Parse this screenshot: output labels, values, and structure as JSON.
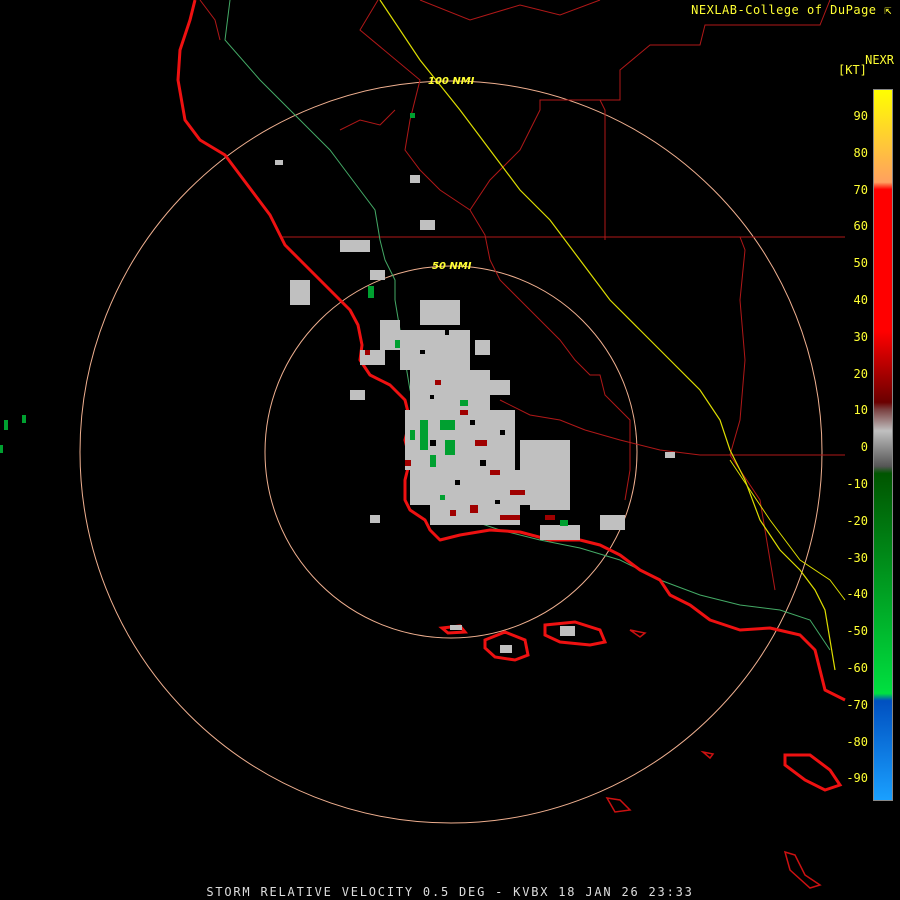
{
  "header": {
    "credit": "NEXLAB-College of DuPage",
    "credit_icon": "cursor-arrow-icon",
    "product": "NEXR",
    "unit": "[KT]"
  },
  "footer": {
    "caption": "STORM RELATIVE VELOCITY 0.5 DEG - KVBX 18 JAN 26 23:33"
  },
  "range_rings": [
    {
      "label": "100 NMI"
    },
    {
      "label": "50 NMI"
    }
  ],
  "legend": {
    "ticks": [
      "90",
      "80",
      "70",
      "60",
      "50",
      "40",
      "30",
      "20",
      "10",
      "0",
      "-10",
      "-20",
      "-30",
      "-40",
      "-50",
      "-60",
      "-70",
      "-80",
      "-90"
    ],
    "colors": {
      "yellow": "#ffff00",
      "orange": "#ffa060",
      "red": "#ff0000",
      "dark_red": "#6a0000",
      "gray": "#c0c0c0",
      "dark_green": "#005500",
      "green": "#00e040",
      "blue": "#0050c0",
      "light_blue": "#1aa0ff"
    }
  },
  "map": {
    "coastline_color": "#ee1111",
    "county_color": "#b01818",
    "road_green_color": "#44aa66",
    "road_yellow_color": "#dddd00",
    "ring_color": "#f0b090"
  }
}
